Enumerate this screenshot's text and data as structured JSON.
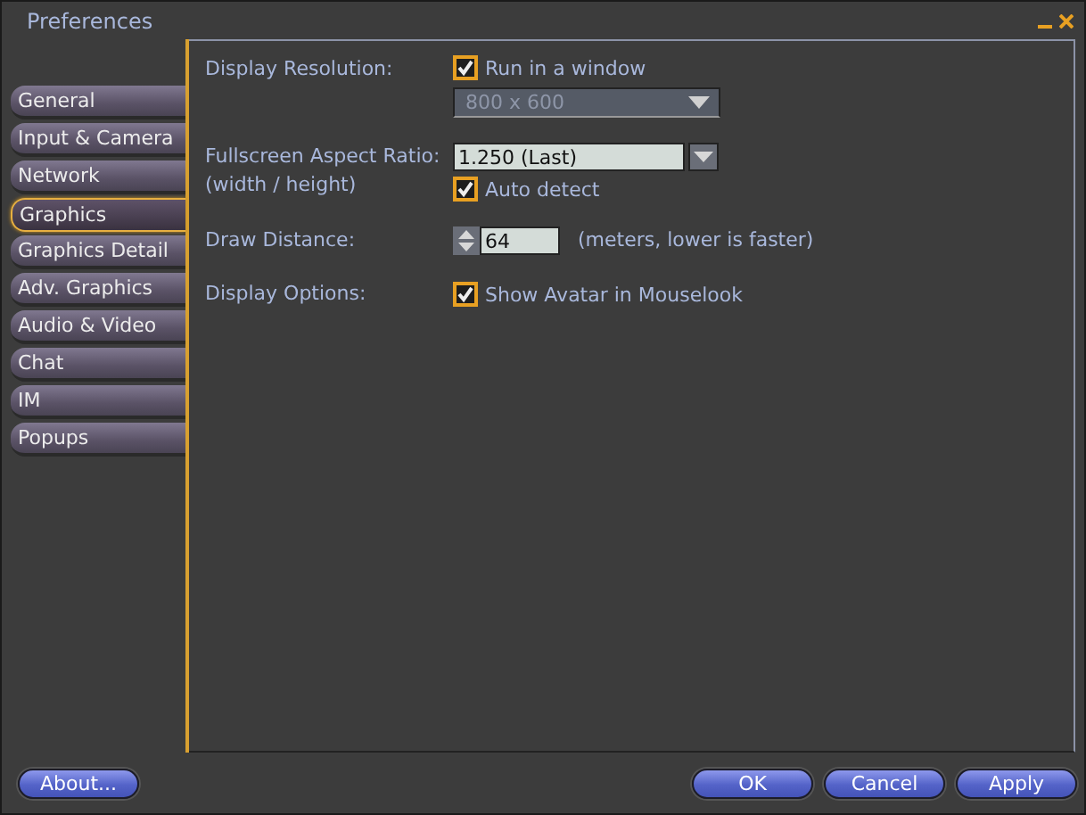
{
  "window": {
    "title": "Preferences"
  },
  "tabs": [
    {
      "label": "General",
      "selected": false
    },
    {
      "label": "Input & Camera",
      "selected": false
    },
    {
      "label": "Network",
      "selected": false
    },
    {
      "label": "Graphics",
      "selected": true
    },
    {
      "label": "Graphics Detail",
      "selected": false
    },
    {
      "label": "Adv. Graphics",
      "selected": false
    },
    {
      "label": "Audio & Video",
      "selected": false
    },
    {
      "label": "Chat",
      "selected": false
    },
    {
      "label": "IM",
      "selected": false
    },
    {
      "label": "Popups",
      "selected": false
    }
  ],
  "display_resolution": {
    "label": "Display Resolution:",
    "run_in_window": {
      "label": "Run in a window",
      "checked": true
    },
    "resolution": {
      "value": "800 x 600",
      "disabled": true
    }
  },
  "aspect_ratio": {
    "label": "Fullscreen Aspect Ratio:",
    "sublabel": "(width / height)",
    "value": "1.250 (Last)",
    "auto_detect": {
      "label": "Auto detect",
      "checked": true
    }
  },
  "draw_distance": {
    "label": "Draw Distance:",
    "value": "64",
    "hint": "(meters, lower is faster)"
  },
  "display_options": {
    "label": "Display Options:",
    "show_avatar": {
      "label": "Show Avatar in Mouselook",
      "checked": true
    }
  },
  "buttons": {
    "about": "About...",
    "ok": "OK",
    "cancel": "Cancel",
    "apply": "Apply"
  }
}
